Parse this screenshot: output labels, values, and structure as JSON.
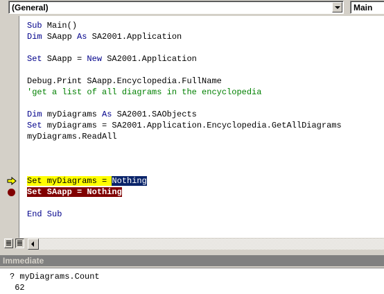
{
  "object_combo": {
    "value": "(General)"
  },
  "procedure_combo": {
    "value": "Main"
  },
  "code": {
    "l1_kw": "Sub",
    "l1_rest": " Main()",
    "l2_kw1": "Dim",
    "l2_mid": " SAapp ",
    "l2_kw2": "As",
    "l2_rest": " SA2001.Application",
    "l3_kw1": "Set",
    "l3_mid": " SAapp = ",
    "l3_kw2": "New",
    "l3_rest": " SA2001.Application",
    "l4_text": "Debug.Print SAapp.Encyclopedia.FullName",
    "l5_comment": "'get a list of all diagrams in the encyclopedia",
    "l6_kw1": "Dim",
    "l6_mid": " myDiagrams ",
    "l6_kw2": "As",
    "l6_rest": " SA2001.SAObjects",
    "l7_kw": "Set",
    "l7_rest": " myDiagrams = SA2001.Application.Encyclopedia.GetAllDiagrams",
    "l8_text": "myDiagrams.ReadAll",
    "l9_part1": "Set myDiagrams = ",
    "l9_part2": "Nothing",
    "l10_text": "Set SAapp = Nothing",
    "l11_kw": "End Sub"
  },
  "immediate": {
    "title": "Immediate",
    "line1": "? myDiagrams.Count",
    "line2": " 62"
  },
  "icons": {
    "execution_point": "execution-arrow-icon",
    "breakpoint": "breakpoint-icon",
    "procedure_view": "procedure-view-icon",
    "full_module_view": "full-module-view-icon",
    "scroll_left": "scroll-left-icon"
  },
  "colors": {
    "keyword": "#00008b",
    "comment": "#008000",
    "execution_highlight": "#ffff00",
    "selection": "#0a246a",
    "breakpoint": "#800000"
  }
}
